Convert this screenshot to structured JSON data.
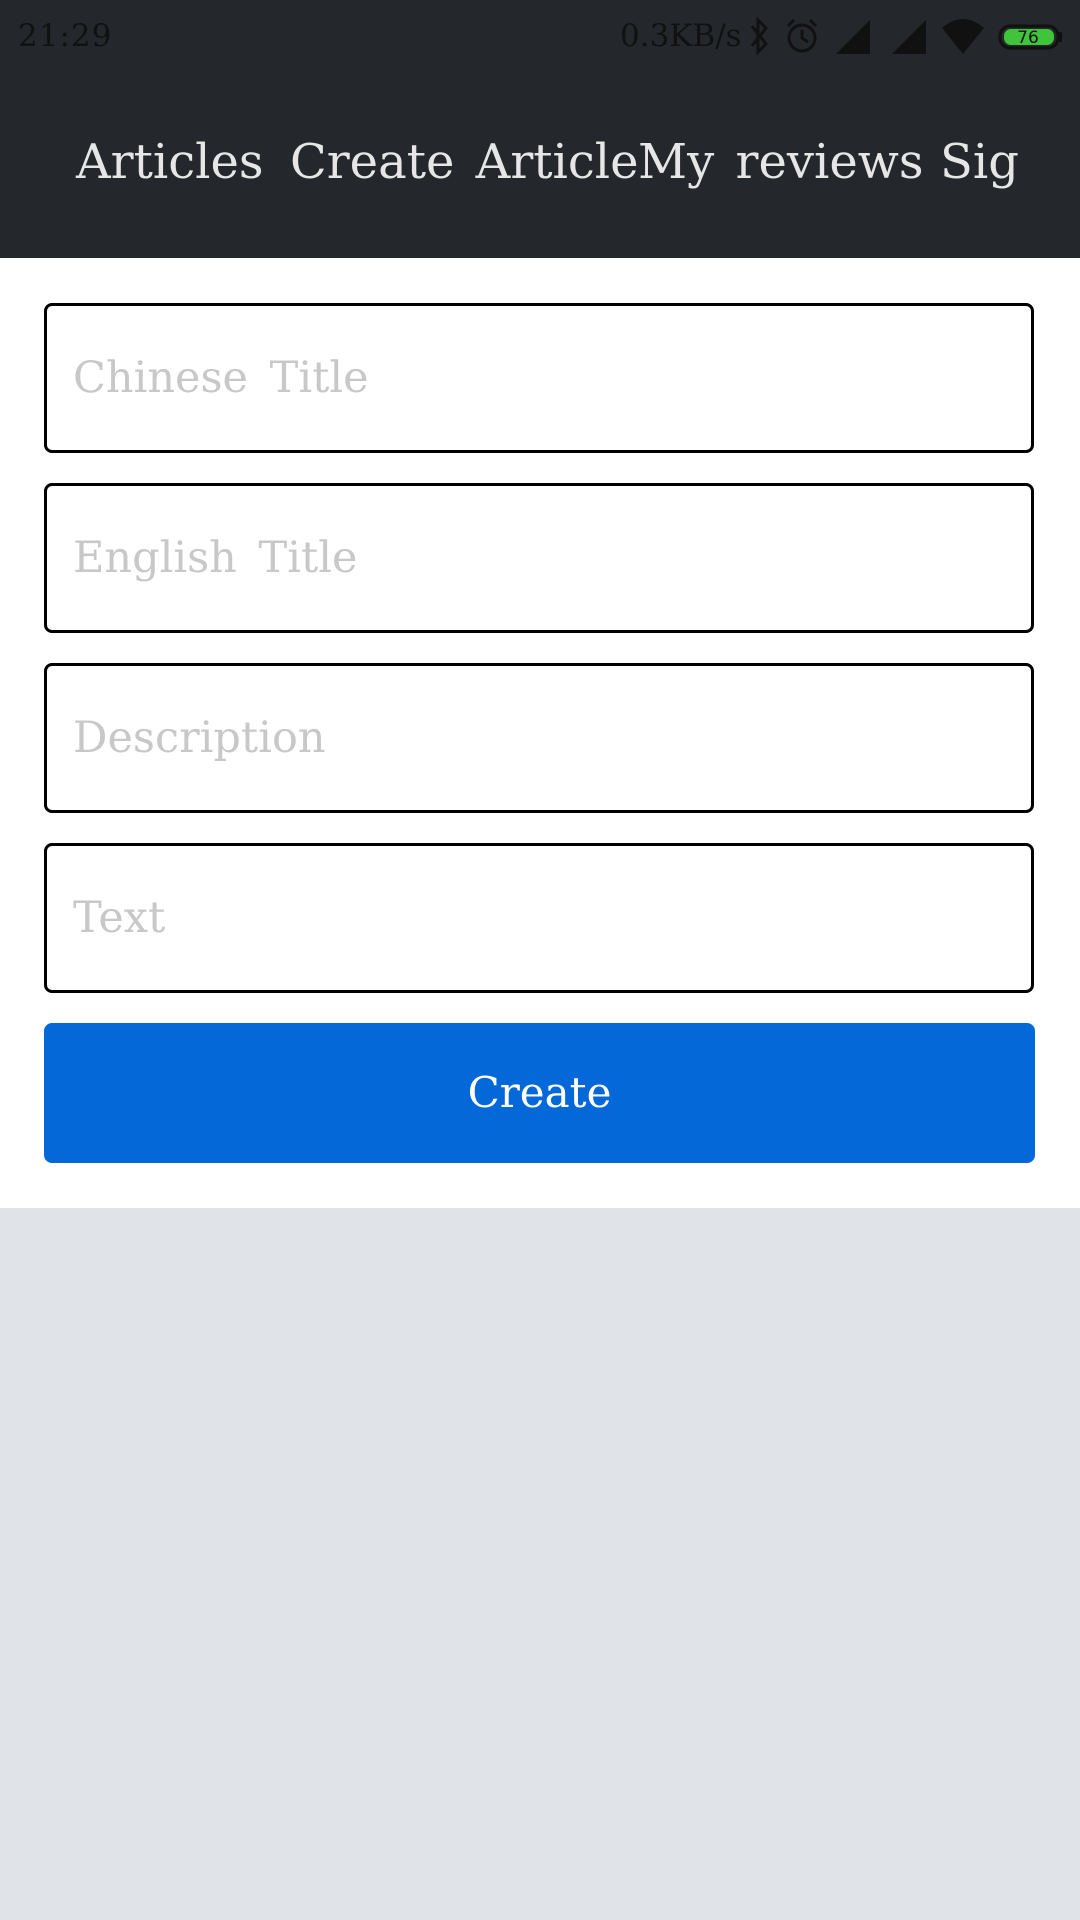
{
  "status_bar": {
    "time": "21:29",
    "network_speed": "0.3KB/s",
    "battery_level": "76",
    "battery_color": "#3fc43a",
    "icons": [
      "bluetooth-icon",
      "alarm-icon",
      "signal-icon",
      "signal-icon",
      "wifi-icon",
      "battery-icon"
    ]
  },
  "nav": {
    "items": [
      {
        "label": "Articles"
      },
      {
        "label": "Create Article"
      },
      {
        "label": "My reviews"
      },
      {
        "label": "Sig"
      }
    ]
  },
  "form": {
    "chinese_title_placeholder": "Chinese Title",
    "english_title_placeholder": "English Title",
    "description_placeholder": "Description",
    "text_placeholder": "Text",
    "create_label": "Create"
  },
  "colors": {
    "header_bg": "#24282c",
    "primary": "#0568d8",
    "page_bg": "#e0e3e8"
  }
}
